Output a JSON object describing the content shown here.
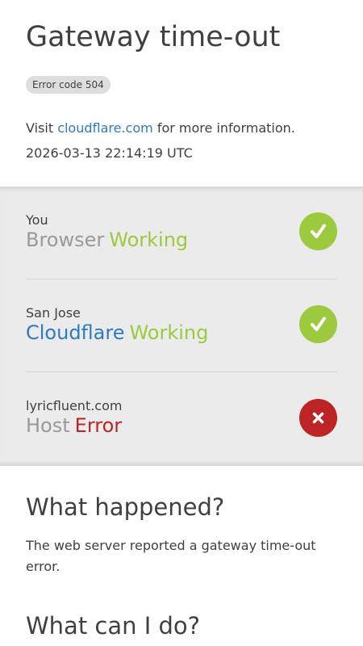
{
  "header": {
    "title": "Gateway time-out",
    "error_badge": "Error code 504",
    "visit_prefix": "Visit",
    "visit_link": "cloudflare.com",
    "visit_suffix": "for more information.",
    "timestamp": "2026-03-13 22:14:19 UTC"
  },
  "status": {
    "rows": [
      {
        "location": "You",
        "name": "Browser",
        "state": "Working",
        "icon": "check-icon",
        "ok": true
      },
      {
        "location": "San Jose",
        "name": "Cloudflare",
        "state": "Working",
        "icon": "check-icon",
        "ok": true
      },
      {
        "location": "lyricfluent.com",
        "name": "Host",
        "state": "Error",
        "icon": "close-icon",
        "ok": false
      }
    ]
  },
  "what_happened": {
    "title": "What happened?",
    "text": "The web server reported a gateway time-out error."
  },
  "what_can_i_do": {
    "title": "What can I do?"
  },
  "colors": {
    "working": "#9bca3e",
    "error": "#bd2426",
    "link": "#2f7bbf",
    "panel_bg": "#ebebeb",
    "badge_bg": "#dedede"
  }
}
